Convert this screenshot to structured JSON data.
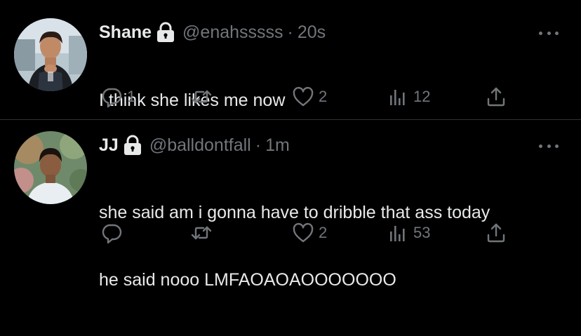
{
  "tweets": [
    {
      "name": "Shane",
      "handle": "@enahsssss",
      "separator": "·",
      "time": "20s",
      "lines": [
        "I think she likes me now"
      ],
      "replies": "1",
      "retweets": "",
      "likes": "2",
      "views": "12"
    },
    {
      "name": "JJ",
      "handle": "@balldontfall",
      "separator": "·",
      "time": "1m",
      "lines": [
        "she said am i gonna have to dribble that ass today",
        "he said nooo LMFAOAOAOOOOOOO"
      ],
      "replies": "",
      "retweets": "",
      "likes": "2",
      "views": "53"
    }
  ],
  "icons": {
    "lock": "lock-icon",
    "more": "more-icon",
    "reply": "reply-icon",
    "retweet": "retweet-icon",
    "like": "heart-icon",
    "views": "views-icon",
    "share": "share-icon"
  },
  "colors": {
    "background": "#000000",
    "text": "#e7e9ea",
    "secondary": "#71767b",
    "divider": "#2f3336"
  }
}
